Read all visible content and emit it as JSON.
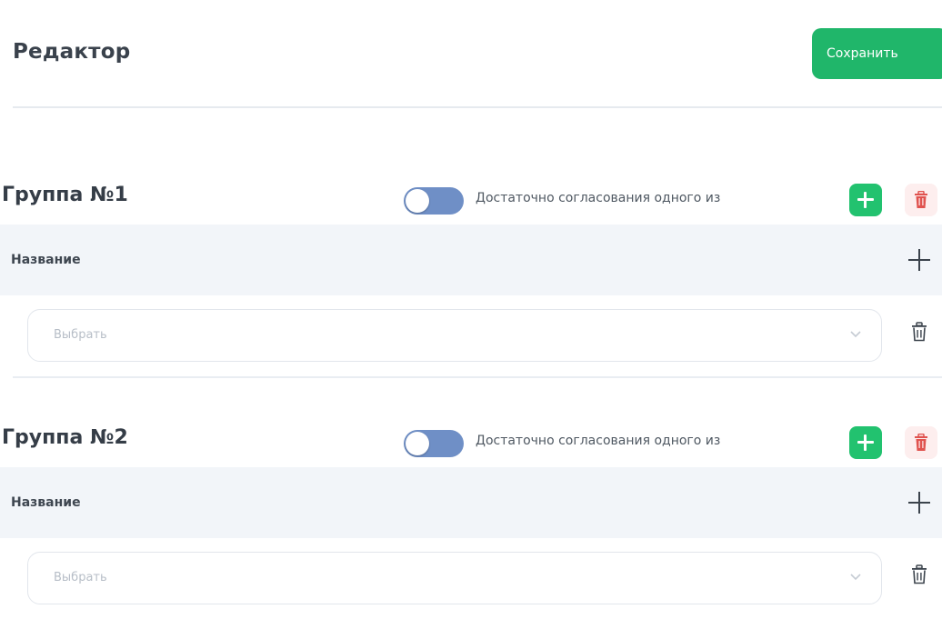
{
  "header": {
    "title": "Редактор",
    "save_label": "Сохранить"
  },
  "groups": [
    {
      "title": "Группа №1",
      "toggle_label": "Достаточно согласования одного из",
      "toggle_on": false,
      "column_title": "Название",
      "select_placeholder": "Выбрать"
    },
    {
      "title": "Группа №2",
      "toggle_label": "Достаточно согласования одного из",
      "toggle_on": false,
      "column_title": "Название",
      "select_placeholder": "Выбрать"
    }
  ],
  "colors": {
    "primary_green": "#20b66a",
    "toggle_track": "#6f8fc6",
    "delete_bg": "#fdeeee",
    "delete_icon": "#e0534f",
    "table_header_bg": "#f2f5f9"
  },
  "icons": {
    "add_group_item": "plus-icon",
    "delete_group": "trash-icon",
    "add_row": "plus-icon",
    "delete_row": "trash-icon",
    "select_dropdown": "chevron-down-icon"
  }
}
